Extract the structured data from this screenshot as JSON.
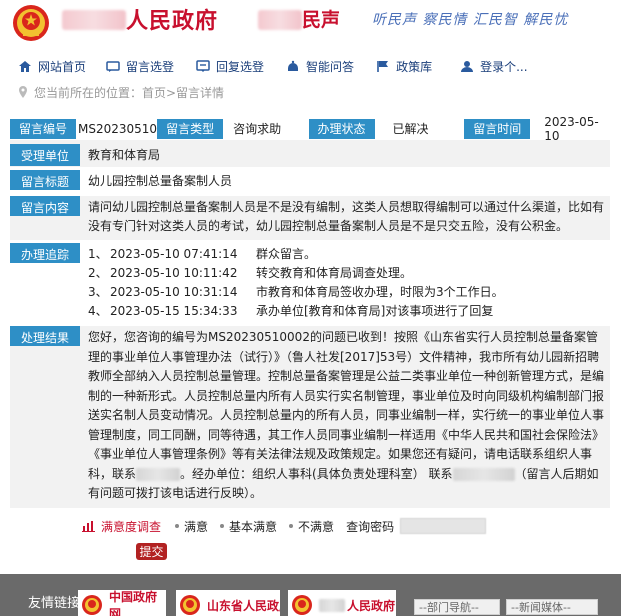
{
  "header": {
    "site_title": "人民政府",
    "site_sub": "民声",
    "slogan": "听民声 察民情 汇民智 解民忧"
  },
  "nav": {
    "items": [
      {
        "label": "网站首页",
        "icon": "home-icon"
      },
      {
        "label": "留言选登",
        "icon": "message-icon"
      },
      {
        "label": "回复选登",
        "icon": "reply-icon"
      },
      {
        "label": "智能问答",
        "icon": "robot-icon"
      },
      {
        "label": "政策库",
        "icon": "flag-icon"
      },
      {
        "label": "登录个...",
        "icon": "user-icon"
      }
    ]
  },
  "breadcrumb": "您当前所在的位置：首页>留言详情",
  "detail": {
    "number_label": "留言编号",
    "number": "MS20230510",
    "type_label": "留言类型",
    "type": "咨询求助",
    "status_label": "办理状态",
    "status": "已解决",
    "time_label": "留言时间",
    "time": "2023-05-10",
    "unit_label": "受理单位",
    "unit": "教育和体育局",
    "subject_label": "留言标题",
    "subject": "幼儿园控制总量备案制人员",
    "content_label": "留言内容",
    "content": "请问幼儿园控制总量备案制人员是不是没有编制，这类人员想取得编制可以通过什么渠道，比如有没有专门针对这类人员的考试，幼儿园控制总量备案制人员是不是只交五险，没有公积金。",
    "track_label": "办理追踪",
    "track": [
      {
        "n": "1、",
        "time": "2023-05-10 07:41:14",
        "text": "群众留言。"
      },
      {
        "n": "2、",
        "time": "2023-05-10 10:11:42",
        "text": "转交教育和体育局调查处理。"
      },
      {
        "n": "3、",
        "time": "2023-05-10 10:31:14",
        "text": "市教育和体育局签收办理，时限为3个工作日。"
      },
      {
        "n": "4、",
        "time": "2023-05-15 15:34:33",
        "text": "承办单位[教育和体育局]对该事项进行了回复"
      }
    ],
    "result_label": "处理结果",
    "result_part1": "您好，您咨询的编号为MS20230510002的问题已收到！按照《山东省实行人员控制总量备案管理的事业单位人事管理办法（试行）》（鲁人社发[2017]53号）文件精神，我市所有幼儿园新招聘教师全部纳入人员控制总量管理。控制总量备案管理是公益二类事业单位一种创新管理方式，是编制的一种新形式。人员控制总量内所有人员实行实名制管理，事业单位及时向同级机构编制部门报送实名制人员变动情况。人员控制总量内的所有人员，同事业编制一样，实行统一的事业单位人事管理制度，同工同酬，同等待遇，其工作人员同事业编制一样适用《中华人民共和国社会保险法》《事业单位人事管理条例》等有关法律法规及政策规定。如果您还有疑问，请电话联系组织人事科，联系",
    "result_part2": "。经办单位：组织人事科(具体负责处理科室）  联系",
    "result_part3": "（留言人后期如有问题可拨打该电话进行反映）。"
  },
  "survey": {
    "title": "满意度调查",
    "options": [
      "满意",
      "基本满意",
      "不满意"
    ],
    "password_label": "查询密码",
    "submit": "提交"
  },
  "footer": {
    "label": "友情链接",
    "links": [
      "中国政府网",
      "山东省人民政府",
      "人民政府"
    ],
    "selects": [
      "--部门导航--",
      "--新闻媒体--"
    ]
  },
  "colors": {
    "brand_red": "#c8102e",
    "label_blue": "#2e8fc6",
    "nav_text": "#1a3e7a",
    "footer_bg": "#6a6a6a"
  }
}
